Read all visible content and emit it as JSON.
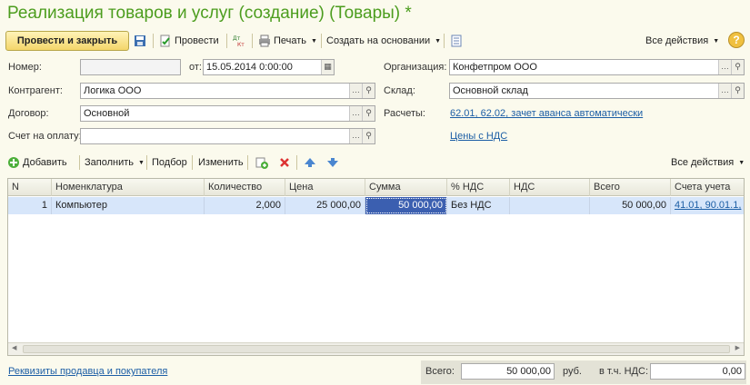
{
  "title": "Реализация товаров и услуг (создание) (Товары) *",
  "toolbar": {
    "post_close": "Провести и закрыть",
    "post": "Провести",
    "print": "Печать",
    "create_based": "Создать на основании",
    "all_actions": "Все действия",
    "help": "?"
  },
  "form": {
    "number_label": "Номер:",
    "number_value": "",
    "date_label": "от:",
    "date_value": "15.05.2014  0:00:00",
    "org_label": "Организация:",
    "org_value": "Конфетпром ООО",
    "contractor_label": "Контрагент:",
    "contractor_value": "Логика ООО",
    "warehouse_label": "Склад:",
    "warehouse_value": "Основной склад",
    "contract_label": "Договор:",
    "contract_value": "Основной",
    "settlements_label": "Расчеты:",
    "settlements_link": "62.01, 62.02, зачет аванса автоматически",
    "invoice_label": "Счет на оплату:",
    "invoice_value": "",
    "vat_link": "Цены с НДС"
  },
  "table_toolbar": {
    "add": "Добавить",
    "fill": "Заполнить",
    "pick": "Подбор",
    "change": "Изменить",
    "all_actions": "Все действия"
  },
  "table": {
    "headers": [
      "N",
      "Номенклатура",
      "Количество",
      "Цена",
      "Сумма",
      "% НДС",
      "НДС",
      "Всего",
      "Счета учета"
    ],
    "rows": [
      {
        "n": "1",
        "item": "Компьютер",
        "qty": "2,000",
        "price": "25 000,00",
        "sum": "50 000,00",
        "vat_rate": "Без НДС",
        "vat": "",
        "total": "50 000,00",
        "accounts": "41.01, 90.01.1,"
      }
    ]
  },
  "footer": {
    "requisites_link": "Реквизиты продавца и покупателя",
    "total_label": "Всего:",
    "total_value": "50 000,00",
    "currency": "руб.",
    "vat_incl_label": "в т.ч. НДС:",
    "vat_incl_value": "0,00"
  }
}
